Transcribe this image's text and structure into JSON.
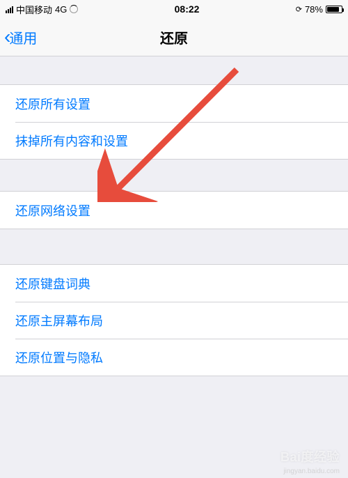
{
  "status": {
    "carrier": "中国移动",
    "network": "4G",
    "time": "08:22",
    "battery_pct": "78%"
  },
  "nav": {
    "back_label": "通用",
    "title": "还原"
  },
  "groups": [
    {
      "rows": [
        {
          "label": "还原所有设置",
          "name": "reset-all-settings"
        },
        {
          "label": "抹掉所有内容和设置",
          "name": "erase-all-content"
        }
      ]
    },
    {
      "rows": [
        {
          "label": "还原网络设置",
          "name": "reset-network-settings"
        }
      ]
    },
    {
      "rows": [
        {
          "label": "还原键盘词典",
          "name": "reset-keyboard-dict"
        },
        {
          "label": "还原主屏幕布局",
          "name": "reset-home-layout"
        },
        {
          "label": "还原位置与隐私",
          "name": "reset-location-privacy"
        }
      ]
    }
  ],
  "annotation": {
    "arrow_target": "reset-network-settings"
  },
  "watermark": {
    "main": "Bai度经验",
    "sub": "jingyan.baidu.com"
  }
}
